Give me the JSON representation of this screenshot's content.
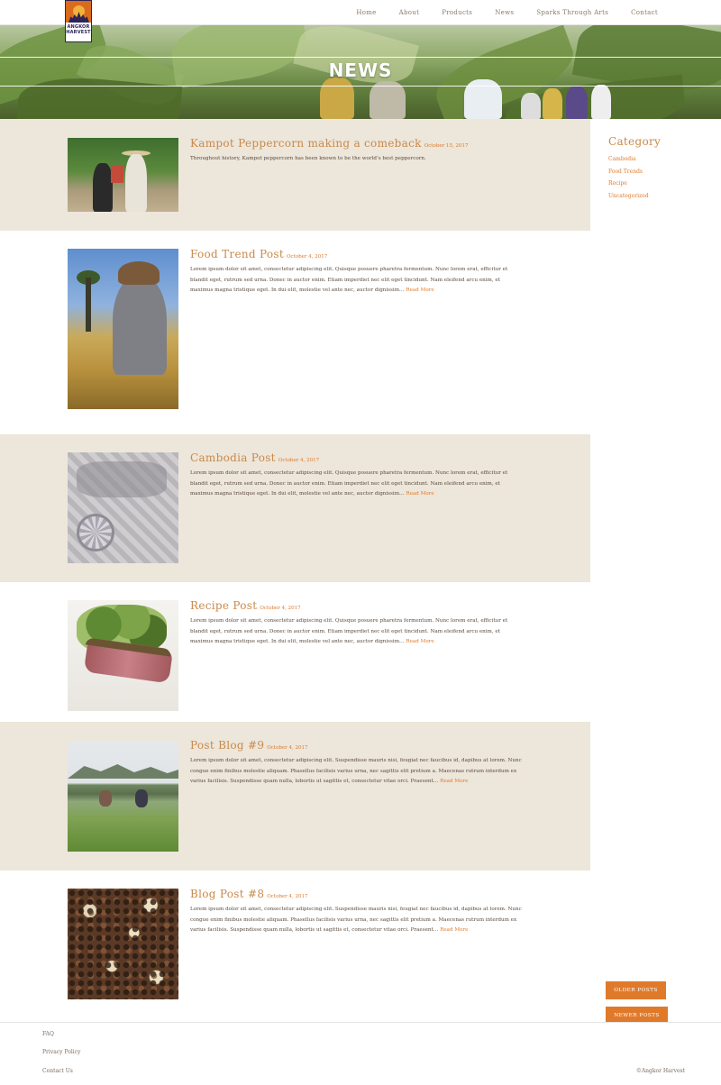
{
  "brand": {
    "logo_line1": "ANGKOR",
    "logo_line2": "HARVEST"
  },
  "nav": [
    {
      "label": "Home"
    },
    {
      "label": "About"
    },
    {
      "label": "Products"
    },
    {
      "label": "News"
    },
    {
      "label": "Sparks Through Arts"
    },
    {
      "label": "Contact"
    }
  ],
  "hero": {
    "title": "NEWS"
  },
  "posts": [
    {
      "title": "Kampot Peppercorn making a comeback",
      "date": "October 15, 2017",
      "excerpt": "Throughout history, Kampot peppercorn has been known to be the world’s best peppercorn.",
      "read_more": ""
    },
    {
      "title": "Food Trend Post",
      "date": "October 4, 2017",
      "excerpt": "Lorem ipsum dolor sit amet, consectetur adipiscing elit. Quisque posuere pharetra fermentum. Nunc lorem erat, efficitur et blandit eget, rutrum sed urna. Donec in auctor enim. Etiam imperdiet nec elit eget tincidunt. Nam eleifend arcu enim, et maximus magna tristique eget. In dui elit, molestie vel ante nec, auctor dignissim…",
      "read_more": "Read More"
    },
    {
      "title": "Cambodia Post",
      "date": "October 4, 2017",
      "excerpt": "Lorem ipsum dolor sit amet, consectetur adipiscing elit. Quisque posuere pharetra fermentum. Nunc lorem erat, efficitur et blandit eget, rutrum sed urna. Donec in auctor enim. Etiam imperdiet nec elit eget tincidunt. Nam eleifend arcu enim, et maximus magna tristique eget. In dui elit, molestie vel ante nec, auctor dignissim…",
      "read_more": "Read More"
    },
    {
      "title": "Recipe Post",
      "date": "October 4, 2017",
      "excerpt": "Lorem ipsum dolor sit amet, consectetur adipiscing elit. Quisque posuere pharetra fermentum. Nunc lorem erat, efficitur et blandit eget, rutrum sed urna. Donec in auctor enim. Etiam imperdiet nec elit eget tincidunt. Nam eleifend arcu enim, et maximus magna tristique eget. In dui elit, molestie vel ante nec, auctor dignissim…",
      "read_more": "Read More"
    },
    {
      "title": "Post Blog #9",
      "date": "October 4, 2017",
      "excerpt": "Lorem ipsum dolor sit amet, consectetur adipiscing elit. Suspendisse mauris nisi, feugiat nec faucibus id, dapibus at lorem. Nunc congue enim finibus molestie aliquam. Phasellus facilisis varius urna, nec sagittis elit pretium a. Maecenas rutrum interdum ex varius facilisis. Suspendisse quam nulla, lobortis ut sagittis et, consectetur vitae orci. Praesent…",
      "read_more": "Read More"
    },
    {
      "title": "Blog Post #8",
      "date": "October 4, 2017",
      "excerpt": "Lorem ipsum dolor sit amet, consectetur adipiscing elit. Suspendisse mauris nisi, feugiat nec faucibus id, dapibus at lorem. Nunc congue enim finibus molestie aliquam. Phasellus facilisis varius urna, nec sagittis elit pretium a. Maecenas rutrum interdum ex varius facilisis. Suspendisse quam nulla, lobortis ut sagittis et, consectetur vitae orci. Praesent…",
      "read_more": "Read More"
    }
  ],
  "sidebar": {
    "title": "Category",
    "categories": [
      "Cambodia",
      "Food Trends",
      "Recipe",
      "Uncategorized"
    ]
  },
  "pagination": {
    "older": "OLDER POSTS",
    "newer": "NEWER POSTS"
  },
  "footer": {
    "links": [
      "FAQ",
      "Privacy Policy",
      "Contact Us"
    ],
    "copyright": "©Angkor Harvest"
  },
  "colors": {
    "accent": "#e07a2b",
    "title": "#c98a4b",
    "band": "#ede6da",
    "logo_navy": "#2c2358"
  }
}
